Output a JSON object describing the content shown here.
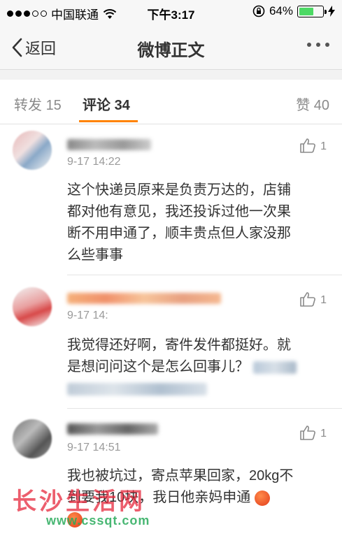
{
  "status_bar": {
    "carrier": "中国联通",
    "time": "下午3:17",
    "battery_percent": "64%",
    "battery_level": 0.64
  },
  "nav": {
    "back_label": "返回",
    "title": "微博正文"
  },
  "tabs": [
    {
      "label": "转发",
      "count": "15"
    },
    {
      "label": "评论",
      "count": "34"
    },
    {
      "label": "赞",
      "count": "40"
    }
  ],
  "comments": [
    {
      "time": "9-17 14:22",
      "likes": "1",
      "text_lines": [
        "这个快递员原来是负责万达的，店铺",
        "都对他有意见，我还投诉过他一次果",
        "断不用申通了，顺丰贵点但人家没那",
        "么些事事"
      ]
    },
    {
      "time": "9-17 14:",
      "likes": "1",
      "text_lines": [
        "我觉得还好啊，寄件发件都挺好。就",
        "是想问问这个是怎么回事儿？"
      ]
    },
    {
      "time": "9-17 14:51",
      "likes": "1",
      "text_lines": [
        "我也被坑过，寄点苹果回家，20kg不",
        "到要我10块，我日他亲妈申通"
      ]
    }
  ],
  "watermark": {
    "title": "长沙生活网",
    "url": "www.cssqt.com"
  },
  "colors": {
    "accent": "#ff8200",
    "gray_text": "#8a8a8a",
    "watermark_red": "#e6283c",
    "watermark_green": "#28aa5a"
  }
}
